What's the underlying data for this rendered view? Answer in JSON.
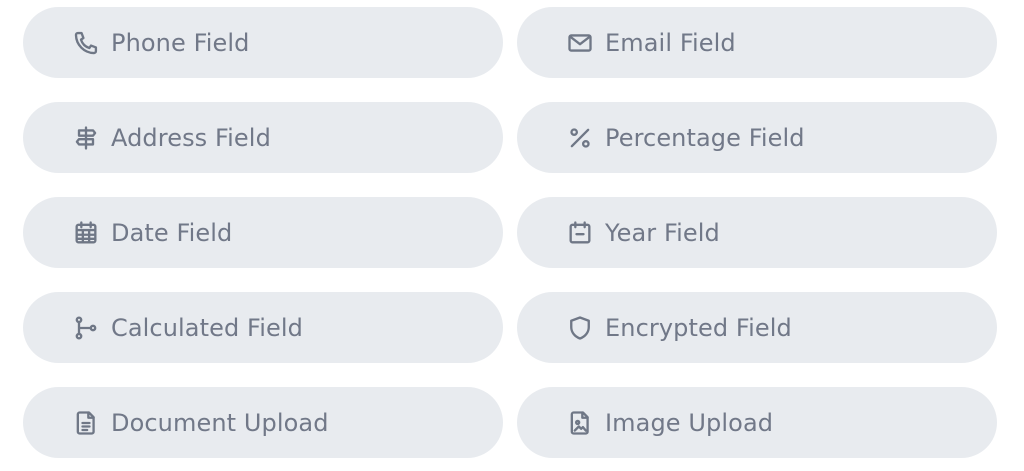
{
  "fields": [
    {
      "label": "Phone Field",
      "icon": "phone-icon"
    },
    {
      "label": "Email Field",
      "icon": "mail-icon"
    },
    {
      "label": "Address Field",
      "icon": "signpost-icon"
    },
    {
      "label": "Percentage Field",
      "icon": "percent-icon"
    },
    {
      "label": "Date Field",
      "icon": "calendar-grid-icon"
    },
    {
      "label": "Year Field",
      "icon": "calendar-minus-icon"
    },
    {
      "label": "Calculated Field",
      "icon": "git-branch-icon"
    },
    {
      "label": "Encrypted Field",
      "icon": "shield-icon"
    },
    {
      "label": "Document Upload",
      "icon": "file-text-icon"
    },
    {
      "label": "Image Upload",
      "icon": "file-image-icon"
    }
  ],
  "colors": {
    "pill_background": "#e8ebef",
    "text": "#717888",
    "icon": "#6f7786"
  }
}
